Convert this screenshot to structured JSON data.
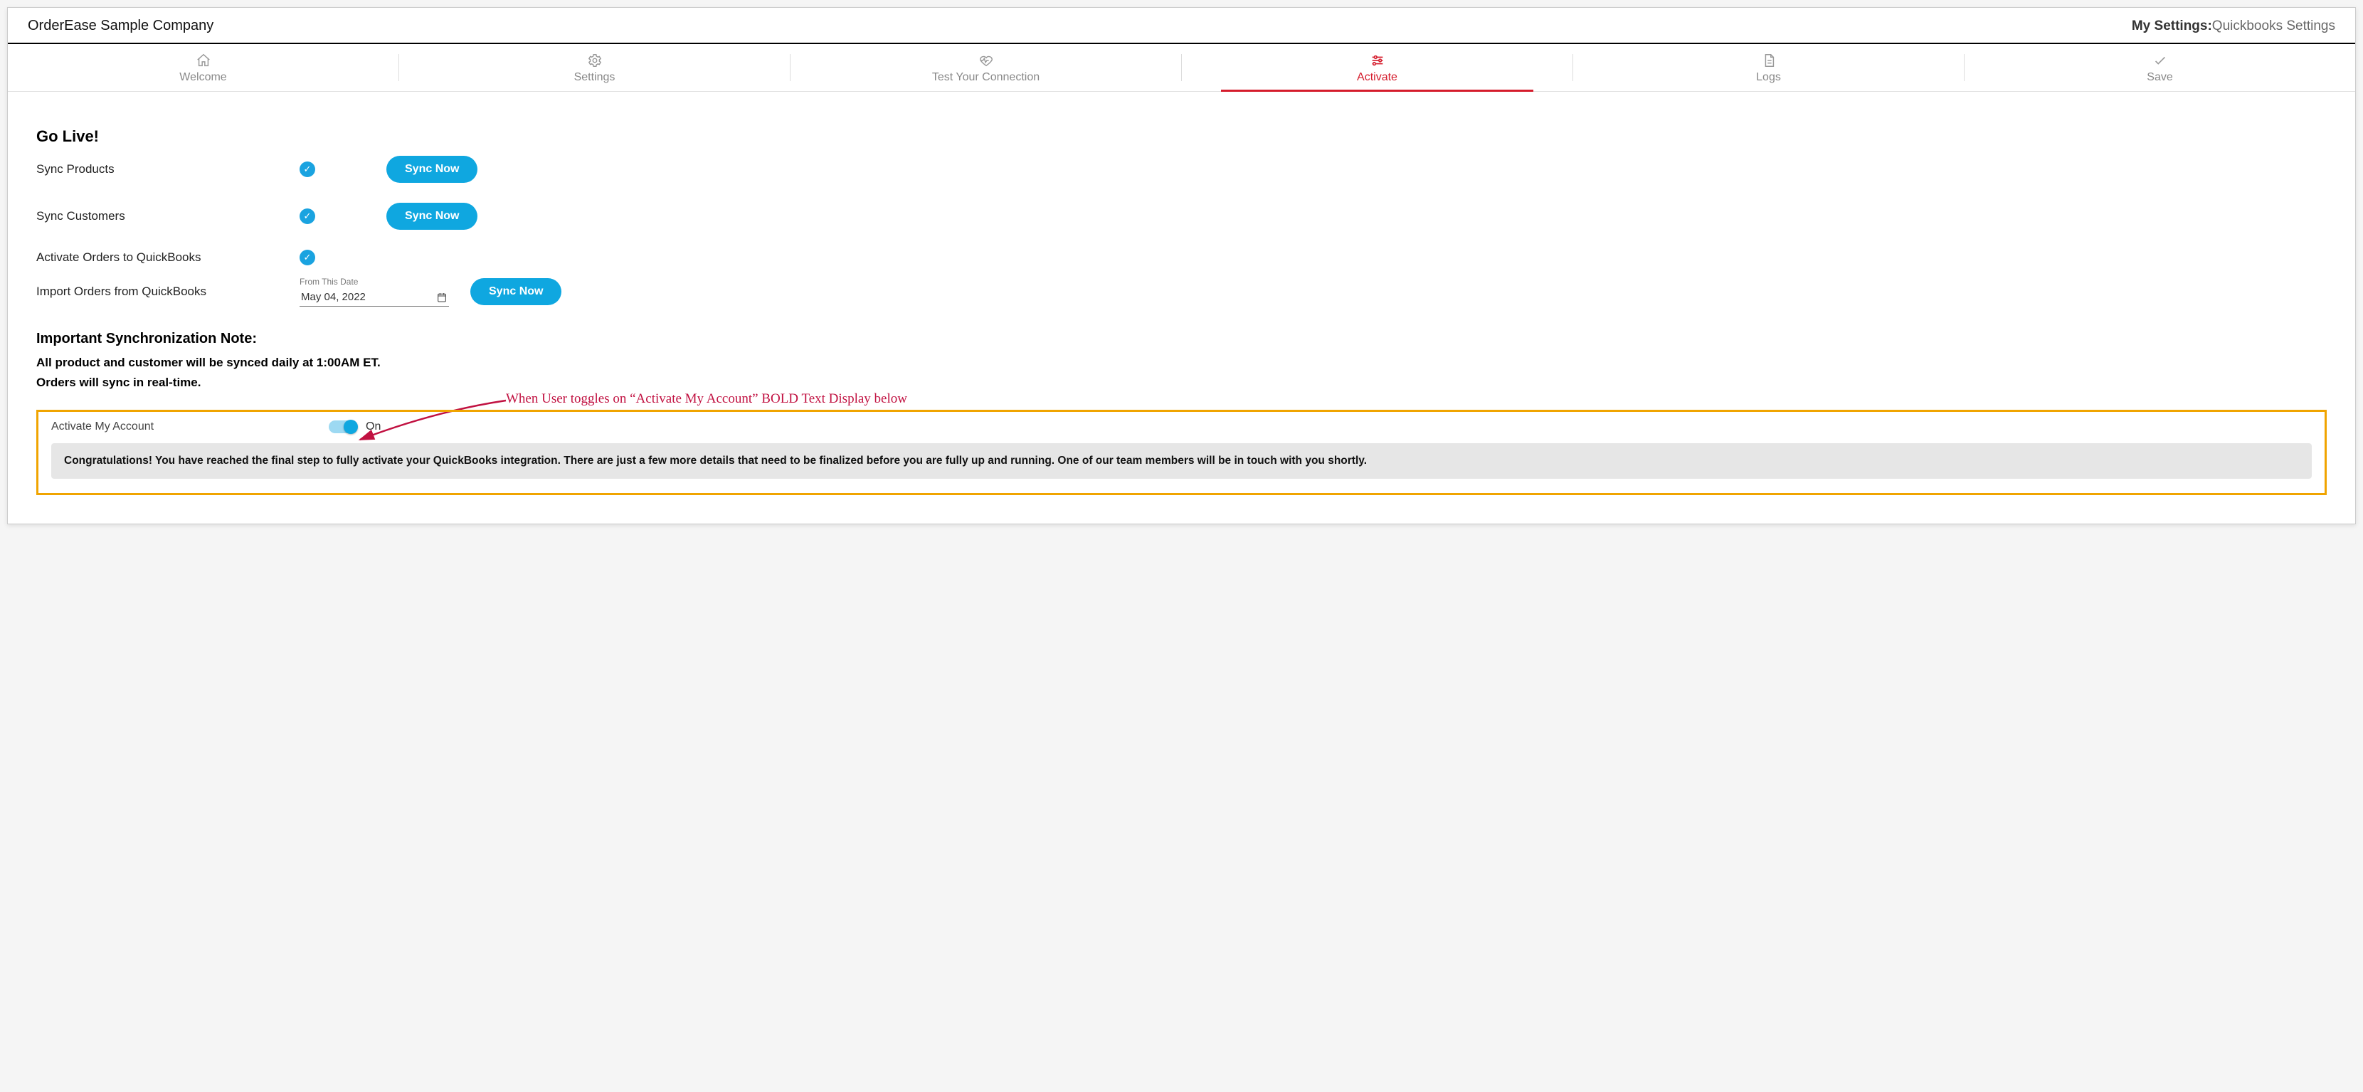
{
  "header": {
    "company": "OrderEase Sample Company",
    "breadcrumb_strong": "My Settings:",
    "breadcrumb_light": "Quickbooks Settings"
  },
  "tabs": {
    "welcome": "Welcome",
    "settings": "Settings",
    "test": "Test Your Connection",
    "activate": "Activate",
    "logs": "Logs",
    "save": "Save"
  },
  "golive": {
    "title": "Go Live!",
    "sync_products_label": "Sync Products",
    "sync_customers_label": "Sync Customers",
    "activate_orders_label": "Activate Orders to QuickBooks",
    "import_orders_label": "Import Orders from QuickBooks",
    "sync_now": "Sync Now",
    "date_field_label": "From This Date",
    "date_value": "May 04, 2022"
  },
  "notes": {
    "title": "Important Synchronization Note:",
    "line1": "All product and customer will be synced daily at 1:00AM ET.",
    "line2": "Orders will sync in real-time."
  },
  "activate_toggle": {
    "label": "Activate My Account",
    "state": "On"
  },
  "congrats": "Congratulations! You have reached the final step to fully activate your QuickBooks integration. There are just a few more details that need to be finalized before you are fully up and running. One of our team members will be in touch with you shortly.",
  "annotation": "When User toggles on “Activate My Account” BOLD Text Display below"
}
